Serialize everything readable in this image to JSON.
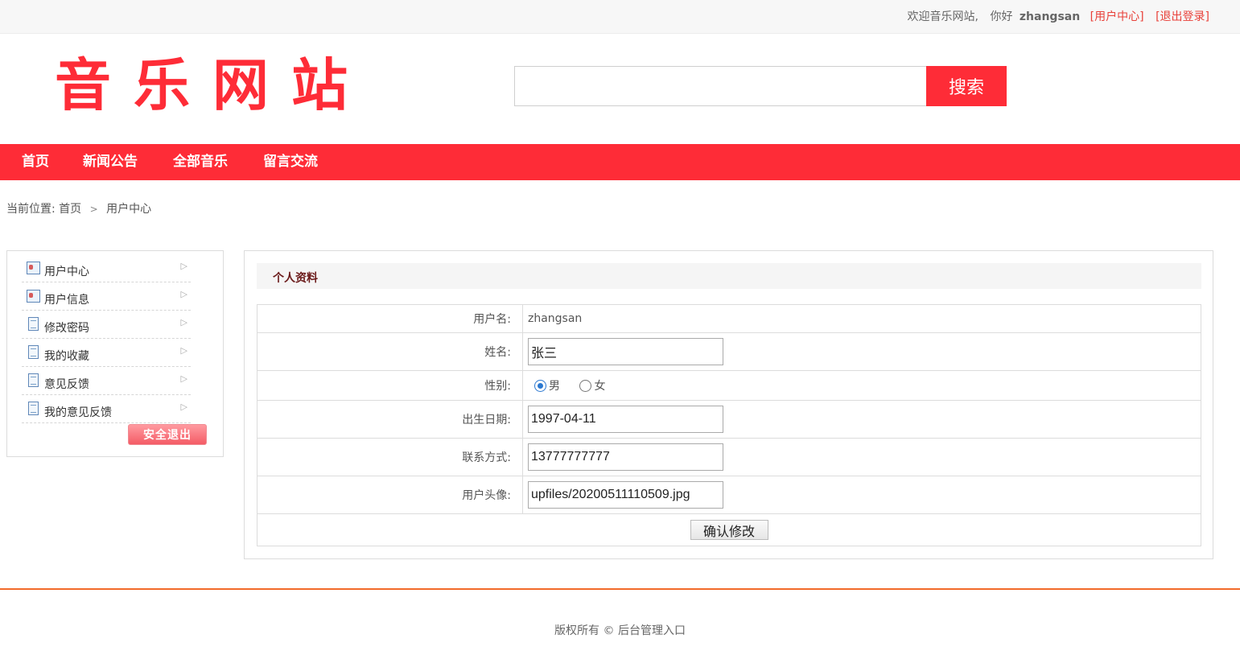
{
  "topbar": {
    "welcome": "欢迎音乐网站,",
    "greeting": "你好",
    "username": "zhangsan",
    "user_center_link": "[用户中心]",
    "logout_link": "[退出登录]"
  },
  "header": {
    "logo_text": "音乐网站",
    "search_placeholder": "",
    "search_button": "搜索"
  },
  "nav": {
    "items": [
      "首页",
      "新闻公告",
      "全部音乐",
      "留言交流"
    ]
  },
  "breadcrumb": {
    "prefix": "当前位置:",
    "home": "首页",
    "current": "用户中心"
  },
  "sidebar": {
    "items": [
      {
        "label": "用户中心",
        "icon": "id-card-icon"
      },
      {
        "label": "用户信息",
        "icon": "id-card-icon"
      },
      {
        "label": "修改密码",
        "icon": "document-icon"
      },
      {
        "label": "我的收藏",
        "icon": "document-icon"
      },
      {
        "label": "意见反馈",
        "icon": "document-icon"
      },
      {
        "label": "我的意见反馈",
        "icon": "document-icon"
      }
    ],
    "logout_button": "安全退出"
  },
  "profile": {
    "title": "个人资料",
    "username_label": "用户名:",
    "username_value": "zhangsan",
    "name_label": "姓名:",
    "name_value": "张三",
    "gender_label": "性别:",
    "gender_options": [
      "男",
      "女"
    ],
    "gender_selected": "男",
    "birth_label": "出生日期:",
    "birth_value": "1997-04-11",
    "contact_label": "联系方式:",
    "contact_value": "13777777777",
    "avatar_label": "用户头像:",
    "avatar_value": "upfiles/20200511110509.jpg",
    "submit_button": "确认修改"
  },
  "footer": {
    "text": "版权所有 © 后台管理入口"
  },
  "colors": {
    "brand_red": "#fe2c37",
    "footer_line": "#f26a2a",
    "link_red": "#e8413a"
  }
}
